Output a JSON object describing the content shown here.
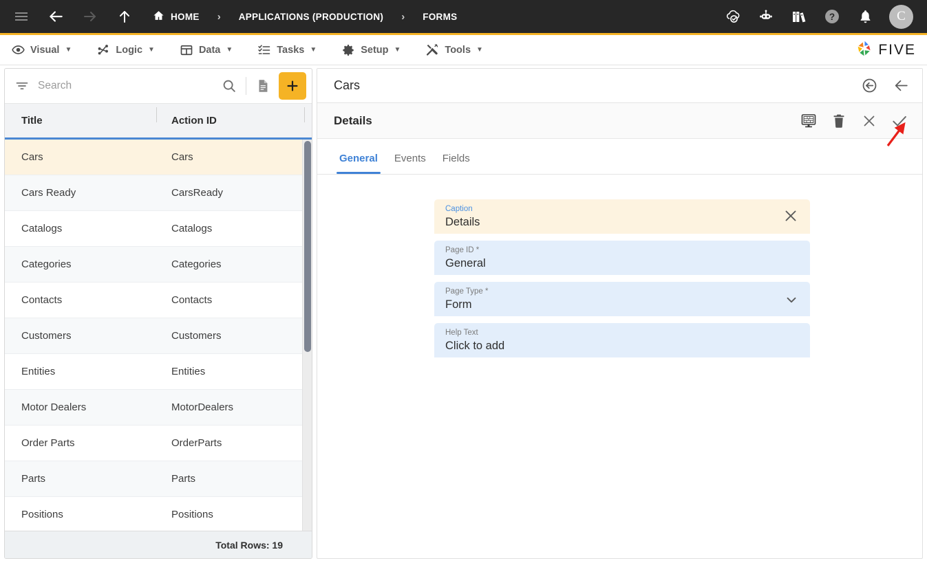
{
  "topbar": {
    "nav_icons": [
      {
        "name": "hamburger-menu-icon",
        "label": "Menu"
      },
      {
        "name": "back-arrow-icon",
        "label": "Back"
      },
      {
        "name": "forward-arrow-icon",
        "label": "Forward"
      },
      {
        "name": "up-arrow-icon",
        "label": "Up"
      }
    ],
    "breadcrumbs": [
      {
        "label": "HOME",
        "icon": "home-icon"
      },
      {
        "label": "APPLICATIONS (PRODUCTION)",
        "icon": ""
      },
      {
        "label": "FORMS",
        "icon": ""
      }
    ],
    "separator": "›",
    "right_icons": [
      {
        "name": "cloud-check-icon"
      },
      {
        "name": "robot-assistant-icon"
      },
      {
        "name": "books-library-icon"
      },
      {
        "name": "help-icon"
      },
      {
        "name": "notifications-bell-icon"
      }
    ],
    "avatar_initial": "C",
    "accent_color": "#f5b325",
    "background_color": "#272727"
  },
  "menubar": {
    "items": [
      {
        "label": "Visual",
        "icon": "eye-icon",
        "caret": "▼"
      },
      {
        "label": "Logic",
        "icon": "logic-nodes-icon",
        "caret": "▼"
      },
      {
        "label": "Data",
        "icon": "data-grid-icon",
        "caret": "▼"
      },
      {
        "label": "Tasks",
        "icon": "tasks-checklist-icon",
        "caret": "▼"
      },
      {
        "label": "Setup",
        "icon": "gear-icon",
        "caret": "▼"
      },
      {
        "label": "Tools",
        "icon": "tools-wrench-icon",
        "caret": "▼"
      }
    ],
    "logo_text": "FIVE"
  },
  "left_panel": {
    "search": {
      "placeholder": "Search",
      "value": "",
      "filter_icon": "filter-icon",
      "search_icon": "search-icon",
      "document_icon": "document-icon",
      "add_button_icon": "plus-icon",
      "add_button_color": "#f5b325"
    },
    "columns": [
      "Title",
      "Action ID"
    ],
    "rows": [
      {
        "title": "Cars",
        "action_id": "Cars",
        "selected": true
      },
      {
        "title": "Cars Ready",
        "action_id": "CarsReady",
        "selected": false
      },
      {
        "title": "Catalogs",
        "action_id": "Catalogs",
        "selected": false
      },
      {
        "title": "Categories",
        "action_id": "Categories",
        "selected": false
      },
      {
        "title": "Contacts",
        "action_id": "Contacts",
        "selected": false
      },
      {
        "title": "Customers",
        "action_id": "Customers",
        "selected": false
      },
      {
        "title": "Entities",
        "action_id": "Entities",
        "selected": false
      },
      {
        "title": "Motor Dealers",
        "action_id": "MotorDealers",
        "selected": false
      },
      {
        "title": "Order Parts",
        "action_id": "OrderParts",
        "selected": false
      },
      {
        "title": "Parts",
        "action_id": "Parts",
        "selected": false
      },
      {
        "title": "Positions",
        "action_id": "Positions",
        "selected": false
      }
    ],
    "footer": "Total Rows: 19",
    "selected_row_color": "#fdf3e0",
    "header_underline_color": "#4a87d3"
  },
  "right_panel": {
    "title": "Cars",
    "title_icons": [
      {
        "name": "revert-circle-arrow-icon"
      },
      {
        "name": "back-arrow-icon"
      }
    ],
    "subtitle": "Details",
    "subtitle_icons": [
      {
        "name": "display-preview-icon"
      },
      {
        "name": "delete-trash-icon"
      },
      {
        "name": "close-x-icon"
      },
      {
        "name": "save-check-icon"
      }
    ],
    "tabs": [
      {
        "label": "General",
        "active": true
      },
      {
        "label": "Events",
        "active": false
      },
      {
        "label": "Fields",
        "active": false
      }
    ],
    "active_tab_color": "#3f82d6",
    "fields": [
      {
        "label": "Caption",
        "value": "Details",
        "focused": true,
        "trailing_icon": "clear-x-icon",
        "required": false
      },
      {
        "label": "Page ID *",
        "value": "General",
        "focused": false,
        "trailing_icon": "",
        "required": true
      },
      {
        "label": "Page Type *",
        "value": "Form",
        "focused": false,
        "trailing_icon": "chevron-down-icon",
        "required": true
      },
      {
        "label": "Help Text",
        "value": "Click to add",
        "focused": false,
        "trailing_icon": "",
        "required": false
      }
    ]
  },
  "annotation": {
    "type": "arrow",
    "color": "#e8201a",
    "points_to": "save-check-icon"
  }
}
